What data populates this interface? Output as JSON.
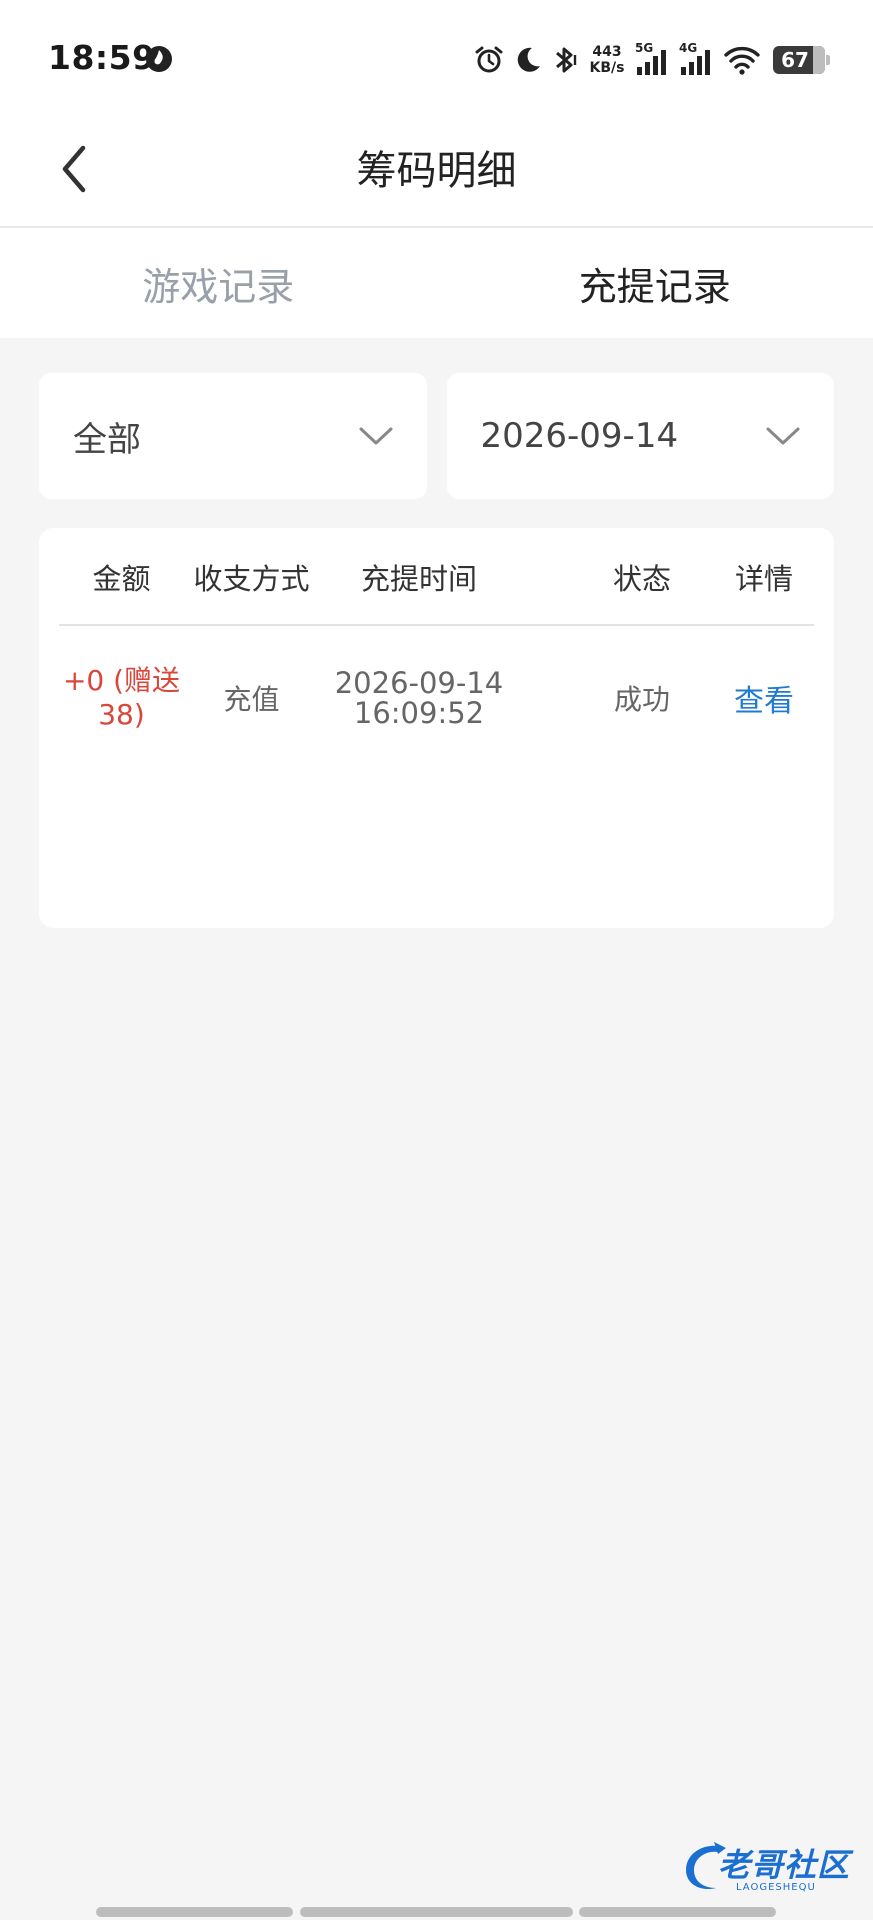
{
  "status_bar": {
    "time": "18:59",
    "net_speed_value": "443",
    "net_speed_unit": "KB/s",
    "sig1_label": "5G",
    "sig2_label": "4G",
    "battery": "67",
    "icons": [
      "app-notification-icon",
      "alarm-icon",
      "moon-icon",
      "bluetooth-icon",
      "signal-icon",
      "signal-icon",
      "wifi-icon",
      "battery-icon"
    ]
  },
  "nav": {
    "title": "筹码明细"
  },
  "tabs": [
    {
      "label": "游戏记录",
      "active": false
    },
    {
      "label": "充提记录",
      "active": true
    }
  ],
  "filters": {
    "type": "全部",
    "date": "2026-09-14"
  },
  "table": {
    "headers": [
      "金额",
      "收支方式",
      "充提时间",
      "状态",
      "详情"
    ],
    "rows": [
      {
        "amount_line1": "+0 (赠送",
        "amount_line2": "38)",
        "method": "充值",
        "date": "2026-09-14",
        "time": "16:09:52",
        "status": "成功",
        "detail": "查看"
      }
    ]
  },
  "watermark": {
    "text": "老哥社区",
    "sub": "LAOGESHEQU"
  },
  "colors": {
    "accent_red": "#d9473b",
    "link_blue": "#1f7ad1",
    "inactive_tab": "#9aa0aa",
    "background": "#f5f5f5"
  }
}
